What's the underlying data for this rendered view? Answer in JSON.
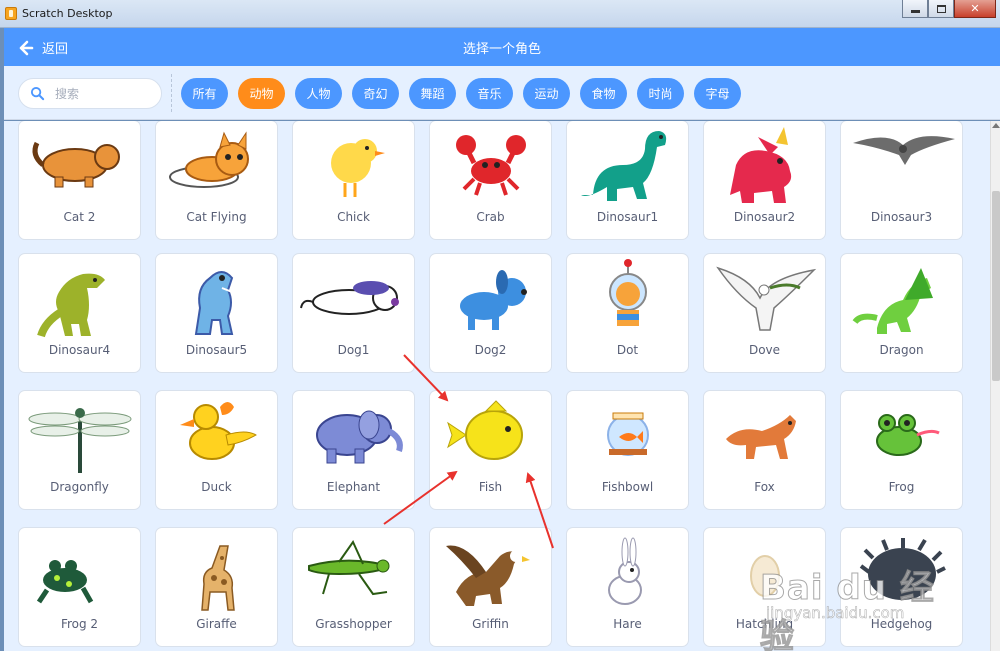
{
  "window": {
    "title": "Scratch Desktop"
  },
  "header": {
    "back_label": "返回",
    "title": "选择一个角色"
  },
  "search": {
    "placeholder": "搜索"
  },
  "tags": [
    {
      "label": "所有",
      "active": false
    },
    {
      "label": "动物",
      "active": true
    },
    {
      "label": "人物",
      "active": false
    },
    {
      "label": "奇幻",
      "active": false
    },
    {
      "label": "舞蹈",
      "active": false
    },
    {
      "label": "音乐",
      "active": false
    },
    {
      "label": "运动",
      "active": false
    },
    {
      "label": "食物",
      "active": false
    },
    {
      "label": "时尚",
      "active": false
    },
    {
      "label": "字母",
      "active": false
    }
  ],
  "sprites": [
    {
      "name": "Cat 2",
      "icon": "cat-2-icon"
    },
    {
      "name": "Cat Flying",
      "icon": "cat-flying-icon"
    },
    {
      "name": "Chick",
      "icon": "chick-icon"
    },
    {
      "name": "Crab",
      "icon": "crab-icon"
    },
    {
      "name": "Dinosaur1",
      "icon": "dinosaur1-icon"
    },
    {
      "name": "Dinosaur2",
      "icon": "dinosaur2-icon"
    },
    {
      "name": "Dinosaur3",
      "icon": "dinosaur3-icon"
    },
    {
      "name": "Dinosaur4",
      "icon": "dinosaur4-icon"
    },
    {
      "name": "Dinosaur5",
      "icon": "dinosaur5-icon"
    },
    {
      "name": "Dog1",
      "icon": "dog1-icon"
    },
    {
      "name": "Dog2",
      "icon": "dog2-icon"
    },
    {
      "name": "Dot",
      "icon": "dot-icon"
    },
    {
      "name": "Dove",
      "icon": "dove-icon"
    },
    {
      "name": "Dragon",
      "icon": "dragon-icon"
    },
    {
      "name": "Dragonfly",
      "icon": "dragonfly-icon"
    },
    {
      "name": "Duck",
      "icon": "duck-icon"
    },
    {
      "name": "Elephant",
      "icon": "elephant-icon"
    },
    {
      "name": "Fish",
      "icon": "fish-icon"
    },
    {
      "name": "Fishbowl",
      "icon": "fishbowl-icon"
    },
    {
      "name": "Fox",
      "icon": "fox-icon"
    },
    {
      "name": "Frog",
      "icon": "frog-icon"
    },
    {
      "name": "Frog 2",
      "icon": "frog-2-icon"
    },
    {
      "name": "Giraffe",
      "icon": "giraffe-icon"
    },
    {
      "name": "Grasshopper",
      "icon": "grasshopper-icon"
    },
    {
      "name": "Griffin",
      "icon": "griffin-icon"
    },
    {
      "name": "Hare",
      "icon": "hare-icon"
    },
    {
      "name": "Hatchling",
      "icon": "hatchling-icon"
    },
    {
      "name": "Hedgehog",
      "icon": "hedgehog-icon"
    }
  ],
  "watermark": {
    "main": "Bai du 经验",
    "sub": "jingyan.baidu.com"
  },
  "colors": {
    "header": "#4c97ff",
    "active_tag": "#ff8c1a",
    "tag": "#4c97ff",
    "background": "#e5f0ff",
    "arrow": "#e8322d"
  }
}
